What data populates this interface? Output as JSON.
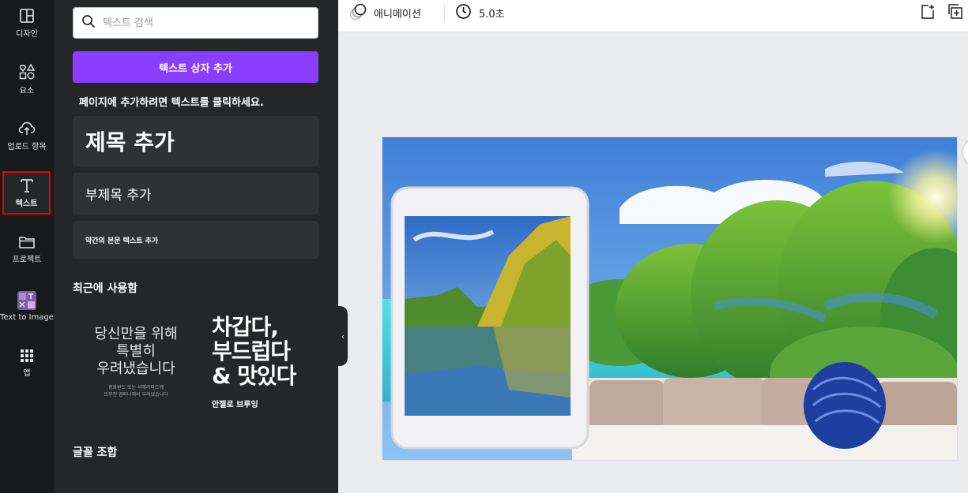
{
  "sidebar": {
    "items": [
      {
        "label": "디자인",
        "icon": "layout-icon"
      },
      {
        "label": "요소",
        "icon": "elements-icon"
      },
      {
        "label": "업로드 항목",
        "icon": "upload-cloud-icon"
      },
      {
        "label": "텍스트",
        "icon": "text-icon"
      },
      {
        "label": "프로젝트",
        "icon": "folder-icon"
      },
      {
        "label": "Text to Image",
        "icon": "text-to-image-icon"
      },
      {
        "label": "앱",
        "icon": "apps-grid-icon"
      }
    ]
  },
  "panel": {
    "search_placeholder": "텍스트 검색",
    "add_textbox": "텍스트 상자 추가",
    "hint": "페이지에 추가하려면 텍스트를 클릭하세요.",
    "heading": "제목 추가",
    "subheading": "부제목 추가",
    "body": "약간의 본문 텍스트 추가",
    "recent_title": "최근에 사용함",
    "recent": [
      {
        "big_lines": [
          "당신만을 위해",
          "특별히",
          "우려냈습니다"
        ],
        "small_lines": [
          "홍화원드 또는 서예라마드께",
          "뜨무진 엽떠나해서 우려냈습니다"
        ]
      },
      {
        "big_lines": [
          "차갑다,",
          "부드럽다",
          "& 맛있다"
        ],
        "small": "안젤로 브루잉"
      }
    ],
    "font_combo_title": "글꼴 조합"
  },
  "toolbar": {
    "animation": "애니메이션",
    "duration": "5.0초"
  },
  "colors": {
    "accent": "#8b3dff",
    "rail_bg": "#18191b",
    "panel_bg": "#252627",
    "highlight_border": "#e00000"
  }
}
